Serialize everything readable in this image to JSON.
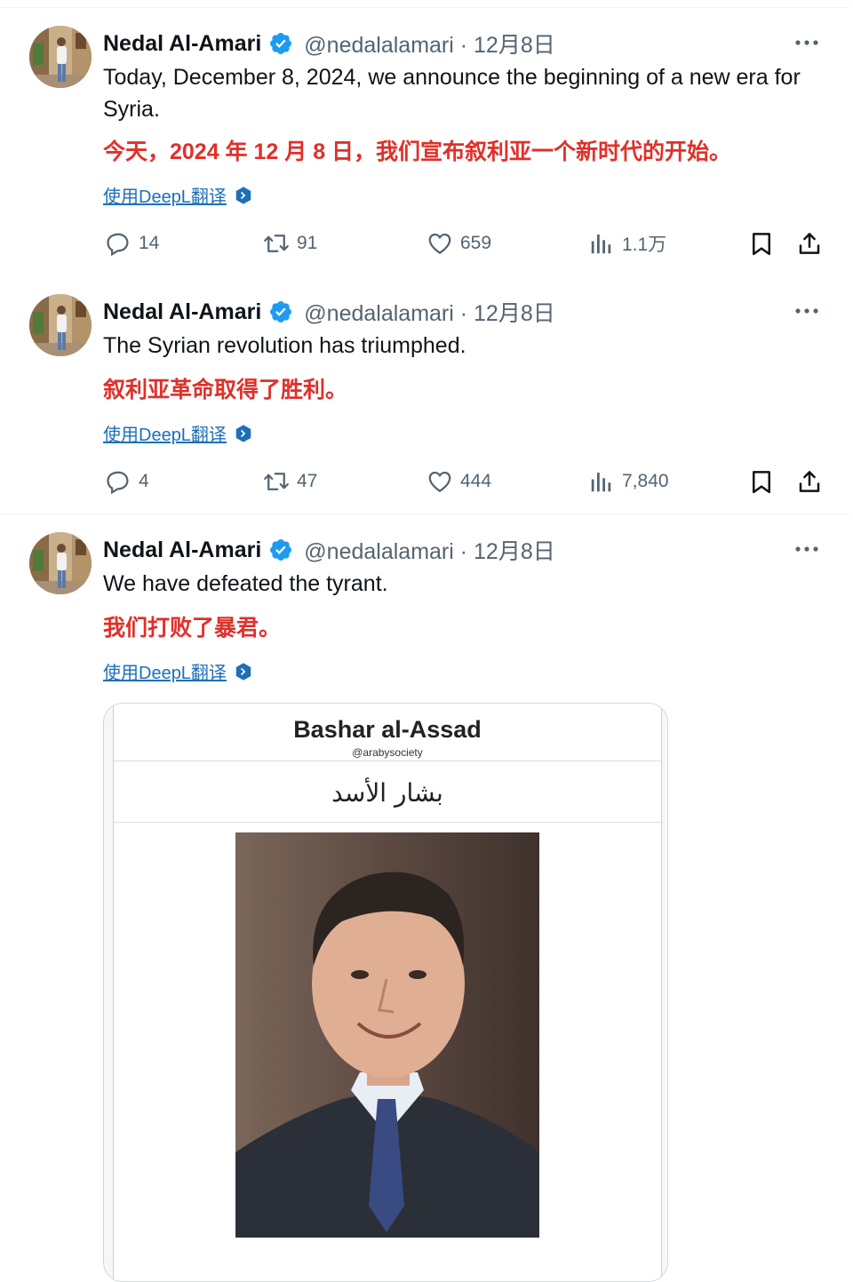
{
  "tweets": [
    {
      "name": "Nedal Al-Amari",
      "handle": "@nedalalamari · 12月8日",
      "text_en": "Today, December 8, 2024, we announce the beginning of a new era for Syria.",
      "text_zh": "今天，2024 年 12 月 8 日，我们宣布叙利亚一个新时代的开始。",
      "translate_link": "使用DeepL翻译",
      "replies": "14",
      "reposts": "91",
      "likes": "659",
      "views": "1.1万"
    },
    {
      "name": "Nedal Al-Amari",
      "handle": "@nedalalamari · 12月8日",
      "text_en": "The Syrian revolution has triumphed.",
      "text_zh": "叙利亚革命取得了胜利。",
      "translate_link": "使用DeepL翻译",
      "replies": "4",
      "reposts": "47",
      "likes": "444",
      "views": "7,840"
    },
    {
      "name": "Nedal Al-Amari",
      "handle": "@nedalalamari · 12月8日",
      "text_en": "We have defeated the tyrant.",
      "text_zh": "我们打败了暴君。",
      "translate_link": "使用DeepL翻译",
      "card": {
        "title": "Bashar al-Assad",
        "subtitle": "@arabysociety",
        "arabic_name": "بشار الأسد"
      }
    }
  ],
  "icons": [
    "verified-badge-icon",
    "more-icon",
    "reply-icon",
    "repost-icon",
    "like-icon",
    "views-icon",
    "bookmark-icon",
    "share-icon",
    "deepl-icon"
  ],
  "colors": {
    "verified": "#1d9bf0",
    "translation_text": "#e0302a",
    "link": "#1d6fb8",
    "secondary_text": "#536471"
  }
}
